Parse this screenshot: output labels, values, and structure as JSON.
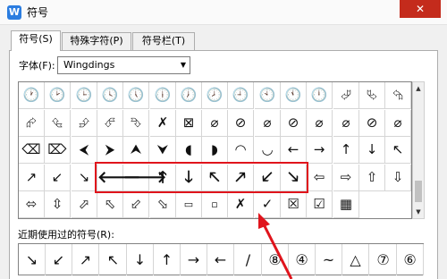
{
  "window": {
    "title": "符号",
    "close_glyph": "✕",
    "app_icon_glyph": "W"
  },
  "tabs": [
    {
      "label": "符号(S)",
      "active": true
    },
    {
      "label": "特殊字符(P)",
      "active": false
    },
    {
      "label": "符号栏(T)",
      "active": false
    }
  ],
  "font": {
    "label": "字体(F):",
    "value": "Wingdings"
  },
  "grid_rows": [
    [
      "🕐",
      "🕑",
      "🕒",
      "🕓",
      "🕔",
      "🕕",
      "🕖",
      "🕗",
      "🕘",
      "🕙",
      "🕚",
      "🕛",
      "⮰",
      "⮱",
      "⮲"
    ],
    [
      "⮳",
      "⮴",
      "⮵",
      "⮶",
      "⮷",
      "✗",
      "⊠",
      "⌀",
      "⊘",
      "⌀",
      "⊘",
      "⌀",
      "⌀",
      "⊘",
      "⌀"
    ],
    [
      "⌫",
      "⌦",
      "⮜",
      "⮞",
      "⮝",
      "⮟",
      "◖",
      "◗",
      "◠",
      "◡",
      "←",
      "→",
      "↑",
      "↓",
      "↖"
    ],
    [
      "↗",
      "↙",
      "↘",
      "🡐",
      "🡒",
      "🡑",
      "🡓",
      "🡔",
      "🡕",
      "🡗",
      "🡖",
      "⇦",
      "⇨",
      "⇧",
      "⇩"
    ],
    [
      "⬄",
      "⇳",
      "⬀",
      "⬁",
      "⬃",
      "⬂",
      "▭",
      "▫",
      "✗",
      "✓",
      "☒",
      "☑",
      "▦"
    ]
  ],
  "recent": {
    "label": "近期使用过的符号(R):",
    "symbols": [
      "↘",
      "↙",
      "↗",
      "↖",
      "↓",
      "↑",
      "→",
      "←",
      "/",
      "⑧",
      "④",
      "~",
      "△",
      "⑦",
      "⑥"
    ]
  },
  "colors": {
    "highlight": "#e0141c",
    "accent": "#2b7de0",
    "close": "#c42b1c"
  }
}
